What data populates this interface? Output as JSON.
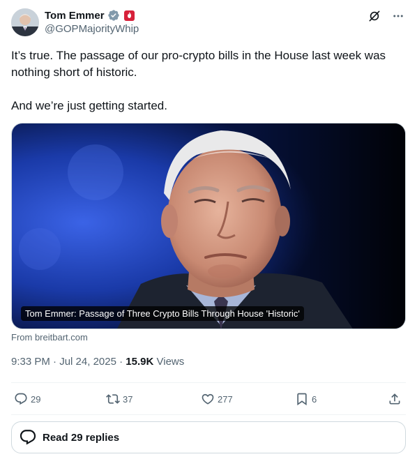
{
  "author": {
    "display_name": "Tom Emmer",
    "handle": "@GOPMajorityWhip"
  },
  "tweet": {
    "line1": "It’s true. The passage of our pro-crypto bills in the House last week was nothing short of historic.",
    "line2": "And we’re just getting started."
  },
  "media": {
    "caption": "Tom Emmer: Passage of Three Crypto Bills Through House 'Historic'",
    "source": "From breitbart.com"
  },
  "meta": {
    "time": "9:33 PM",
    "date": "Jul 24, 2025",
    "views_count": "15.9K",
    "views_label": "Views"
  },
  "actions": {
    "replies": "29",
    "reposts": "37",
    "likes": "277",
    "bookmarks": "6"
  },
  "read_replies": "Read 29 replies",
  "icons": [
    "verified-icon",
    "government-badge-icon",
    "grok-icon",
    "more-icon",
    "reply-icon",
    "repost-icon",
    "like-icon",
    "bookmark-icon",
    "share-icon",
    "chat-bubble-icon"
  ],
  "colors": {
    "text": "#0f1419",
    "secondary": "#536471",
    "verified": "#829aab",
    "badge": "#d7213a",
    "border": "#cfd9de"
  }
}
